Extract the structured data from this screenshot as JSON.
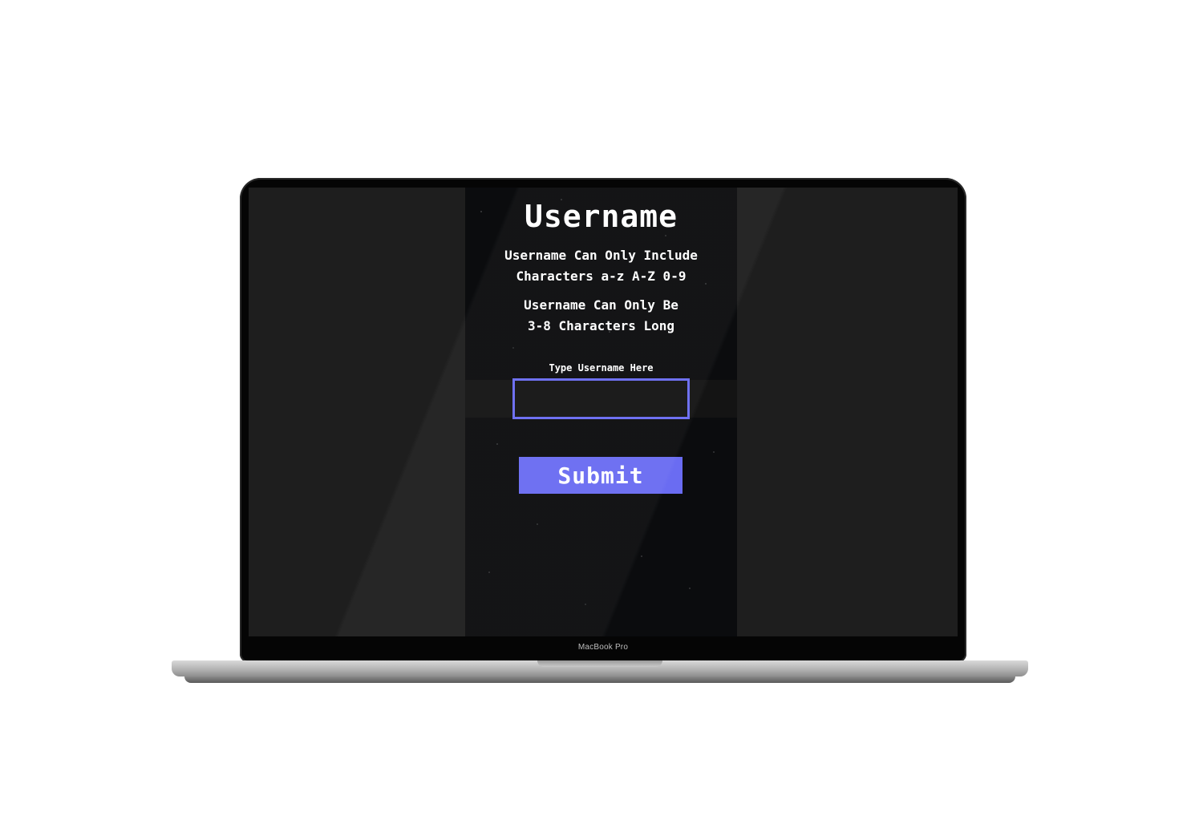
{
  "device": {
    "brand_label": "MacBook Pro"
  },
  "app": {
    "title": "Username",
    "rule_1_line_1": "Username Can Only Include",
    "rule_1_line_2": "Characters a-z A-Z 0-9",
    "rule_2_line_1": "Username Can Only Be",
    "rule_2_line_2": "3-8 Characters Long",
    "field_label": "Type Username Here",
    "input_value": "",
    "submit_label": "Submit"
  },
  "colors": {
    "accent": "#6a6cf2",
    "panel_background": "#0b0c0e",
    "screen_background": "#1e1e1e"
  }
}
